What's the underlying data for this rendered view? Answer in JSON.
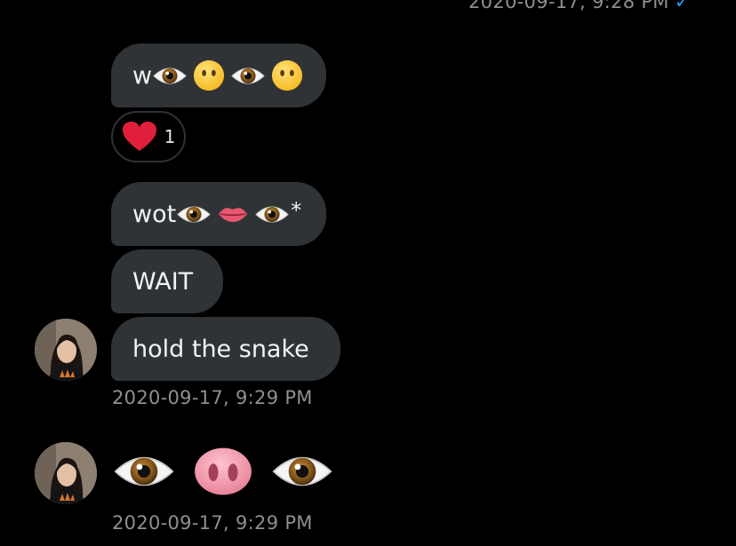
{
  "conversation": {
    "top_timestamp": "2020-09-17, 9:28 PM",
    "top_status_icon": "check-icon",
    "messages": [
      {
        "text": "w",
        "emojis": [
          "eye",
          "no-mouth-face",
          "eye",
          "no-mouth-face"
        ]
      },
      {
        "text": "wot",
        "emojis": [
          "eye",
          "lips",
          "eye"
        ],
        "suffix": "*"
      },
      {
        "text": "WAIT"
      },
      {
        "text": "hold the snake"
      }
    ],
    "reaction": {
      "icon": "heart-icon",
      "count": "1"
    },
    "group1_timestamp": "2020-09-17, 9:29 PM",
    "emoji_message": [
      "eye",
      "pig-nose",
      "eye"
    ],
    "group2_timestamp": "2020-09-17, 9:29 PM"
  },
  "colors": {
    "background": "#000000",
    "bubble": "#2f3336",
    "timestamp": "#8e8e93",
    "check": "#1d9bf0"
  }
}
